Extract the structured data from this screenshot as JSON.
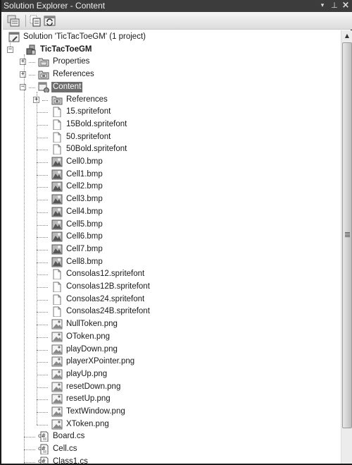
{
  "window": {
    "title": "Solution Explorer - Content",
    "buttons": {
      "dropdown": "▾",
      "pin": "⊥",
      "close": "×"
    }
  },
  "toolbar": {
    "buttons": [
      {
        "name": "properties-button",
        "icon": "properties-icon"
      },
      {
        "name": "show-all-files-button",
        "icon": "show-all-files-icon"
      },
      {
        "name": "refresh-button",
        "icon": "refresh-icon"
      }
    ]
  },
  "tree": {
    "solution": {
      "label": "Solution 'TicTacToeGM' (1 project)",
      "icon": "solution-icon"
    },
    "project": {
      "label": "TicTacToeGM",
      "icon": "project-icon",
      "expanded": true
    },
    "project_children": [
      {
        "label": "Properties",
        "icon": "properties-folder-icon",
        "expander": "+"
      },
      {
        "label": "References",
        "icon": "references-folder-icon",
        "expander": "+"
      },
      {
        "label": "Content",
        "icon": "content-project-icon",
        "expander": "−",
        "selected": true
      }
    ],
    "content_children": [
      {
        "label": "References",
        "icon": "references-folder-icon",
        "expander": "+"
      },
      {
        "label": "15.spritefont",
        "icon": "file-icon"
      },
      {
        "label": "15Bold.spritefont",
        "icon": "file-icon"
      },
      {
        "label": "50.spritefont",
        "icon": "file-icon"
      },
      {
        "label": "50Bold.spritefont",
        "icon": "file-icon"
      },
      {
        "label": "Cell0.bmp",
        "icon": "bitmap-icon"
      },
      {
        "label": "Cell1.bmp",
        "icon": "bitmap-icon"
      },
      {
        "label": "Cell2.bmp",
        "icon": "bitmap-icon"
      },
      {
        "label": "Cell3.bmp",
        "icon": "bitmap-icon"
      },
      {
        "label": "Cell4.bmp",
        "icon": "bitmap-icon"
      },
      {
        "label": "Cell5.bmp",
        "icon": "bitmap-icon"
      },
      {
        "label": "Cell6.bmp",
        "icon": "bitmap-icon"
      },
      {
        "label": "Cell7.bmp",
        "icon": "bitmap-icon"
      },
      {
        "label": "Cell8.bmp",
        "icon": "bitmap-icon"
      },
      {
        "label": "Consolas12.spritefont",
        "icon": "file-icon"
      },
      {
        "label": "Consolas12B.spritefont",
        "icon": "file-icon"
      },
      {
        "label": "Consolas24.spritefont",
        "icon": "file-icon"
      },
      {
        "label": "Consolas24B.spritefont",
        "icon": "file-icon"
      },
      {
        "label": "NullToken.png",
        "icon": "image-icon"
      },
      {
        "label": "OToken.png",
        "icon": "image-icon"
      },
      {
        "label": "playDown.png",
        "icon": "image-icon"
      },
      {
        "label": "playerXPointer.png",
        "icon": "image-icon"
      },
      {
        "label": "playUp.png",
        "icon": "image-icon"
      },
      {
        "label": "resetDown.png",
        "icon": "image-icon"
      },
      {
        "label": "resetUp.png",
        "icon": "image-icon"
      },
      {
        "label": "TextWindow.png",
        "icon": "image-icon"
      },
      {
        "label": "XToken.png",
        "icon": "image-icon"
      }
    ],
    "code_files": [
      {
        "label": "Board.cs",
        "icon": "csharp-file-icon"
      },
      {
        "label": "Cell.cs",
        "icon": "csharp-file-icon"
      },
      {
        "label": "Class1.cs",
        "icon": "csharp-file-icon"
      }
    ]
  },
  "scrollbar": {
    "position_fraction": 0.0,
    "visible_fraction": 0.95
  },
  "colors": {
    "titlebar": "#3c3c3c",
    "selection": "#6e6e6e",
    "toolbar_top": "#f6f6f6",
    "toolbar_bottom": "#dcdcdc"
  }
}
